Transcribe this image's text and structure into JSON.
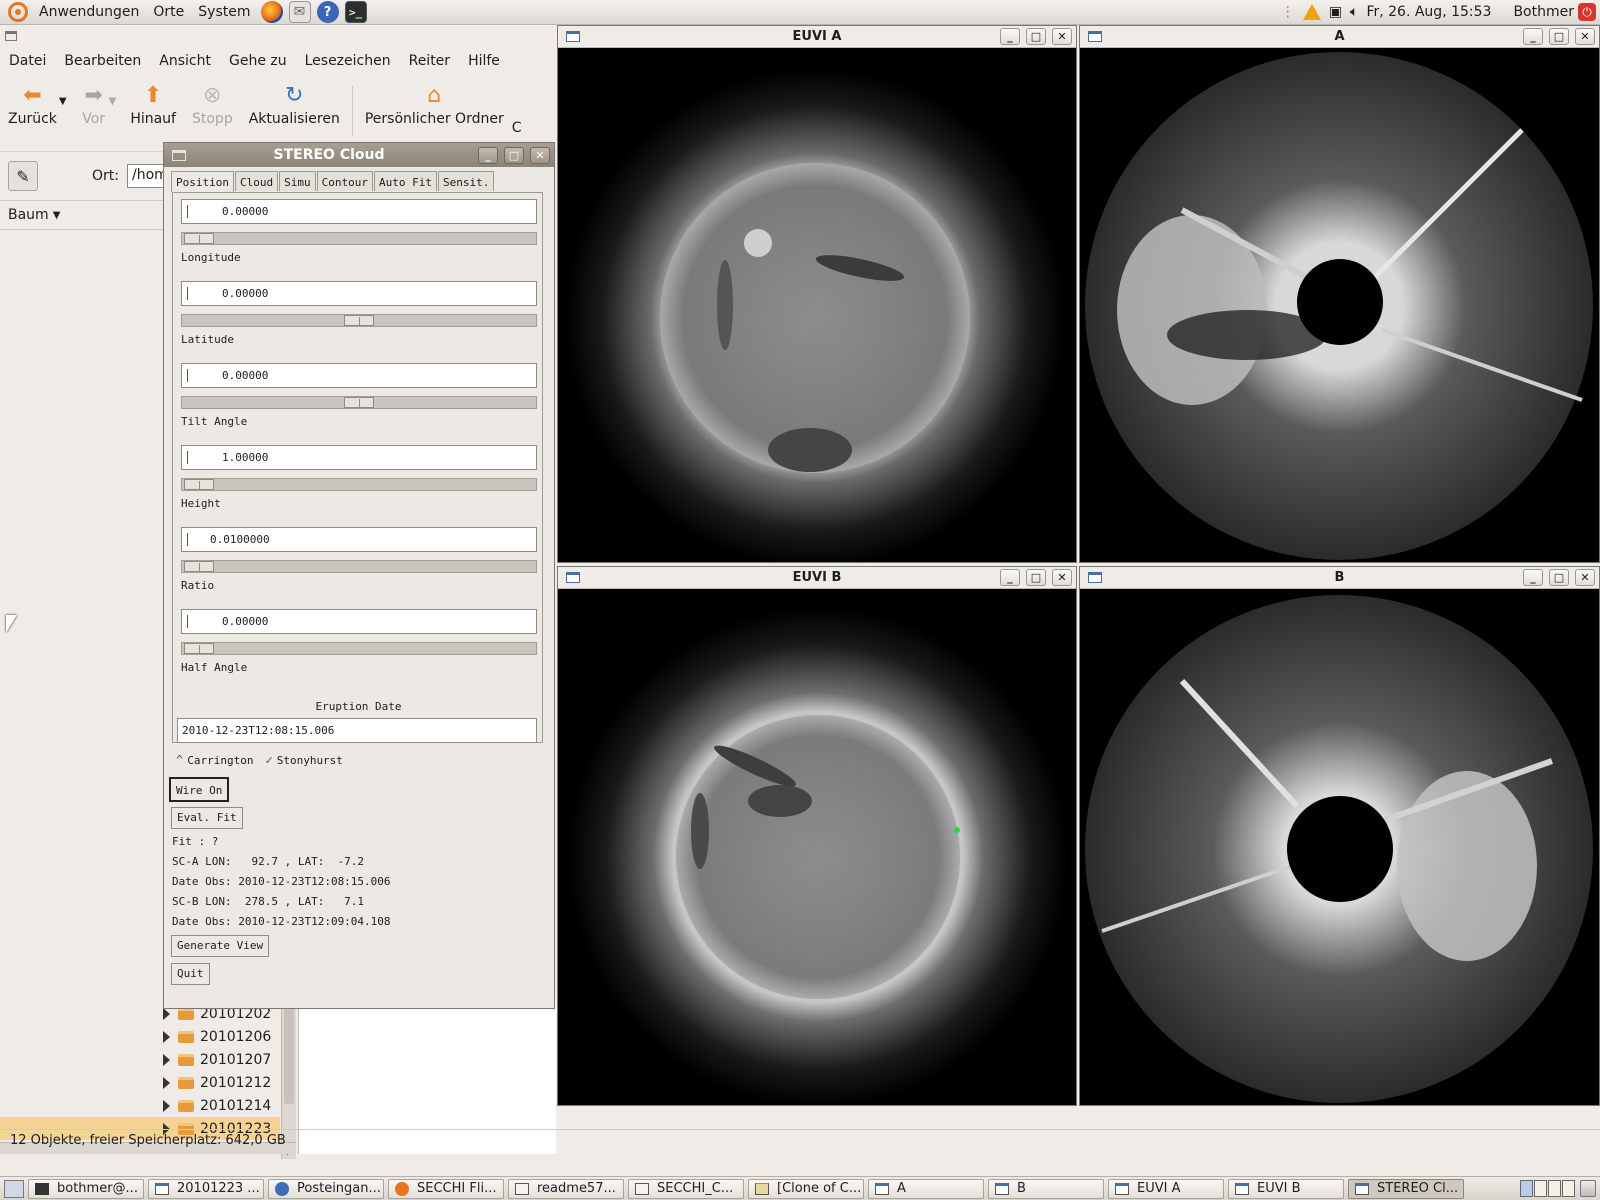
{
  "top_panel": {
    "menus": [
      "Anwendungen",
      "Orte",
      "System"
    ],
    "launchers": [
      "firefox-icon",
      "mail-icon",
      "help-icon",
      "terminal-icon"
    ],
    "clock": "Fr, 26. Aug, 15:53",
    "user": "Bothmer"
  },
  "nautilus": {
    "menubar": [
      "Datei",
      "Bearbeiten",
      "Ansicht",
      "Gehe zu",
      "Lesezeichen",
      "Reiter",
      "Hilfe"
    ],
    "toolbar": {
      "back": "Zurück",
      "forward": "Vor",
      "up": "Hinauf",
      "stop": "Stopp",
      "reload": "Aktualisieren",
      "home": "Persönlicher Ordner",
      "more": "C"
    },
    "location_label": "Ort:",
    "location_value": "/hom",
    "sidebar_mode": "Baum",
    "tree": [
      {
        "name": "20101202",
        "selected": false
      },
      {
        "name": "20101206",
        "selected": false
      },
      {
        "name": "20101207",
        "selected": false
      },
      {
        "name": "20101212",
        "selected": false
      },
      {
        "name": "20101214",
        "selected": false
      },
      {
        "name": "20101223",
        "selected": true
      }
    ],
    "status": "12 Objekte, freier Speicherplatz: 642,0 GB"
  },
  "image_windows": {
    "euvi_a": {
      "title": "EUVI A"
    },
    "cor_a": {
      "title": "A"
    },
    "euvi_b": {
      "title": "EUVI B"
    },
    "cor_b": {
      "title": "B"
    }
  },
  "stereo": {
    "title": "STEREO Cloud",
    "tabs": [
      "Position",
      "Cloud",
      "Simu",
      "Contour",
      "Auto Fit",
      "Sensit."
    ],
    "active_tab": "Position",
    "fields": [
      {
        "label": "Longitude",
        "value": "0.00000",
        "slider_fraction": 0.0
      },
      {
        "label": "Latitude",
        "value": "0.00000",
        "slider_fraction": 0.5
      },
      {
        "label": "Tilt Angle",
        "value": "0.00000",
        "slider_fraction": 0.5
      },
      {
        "label": "Height",
        "value": "1.00000",
        "slider_fraction": 0.0
      },
      {
        "label": "Ratio",
        "value": "0.0100000",
        "slider_fraction": 0.0
      },
      {
        "label": "Half Angle",
        "value": "0.00000",
        "slider_fraction": 0.0
      }
    ],
    "eruption_label": "Eruption Date",
    "eruption_value": "2010-12-23T12:08:15.006",
    "radios": [
      {
        "label": "Carrington",
        "mark": "^"
      },
      {
        "label": "Stonyhurst",
        "mark": "✓"
      }
    ],
    "buttons": {
      "wire": "Wire On",
      "eval": "Eval. Fit",
      "generate": "Generate View",
      "quit": "Quit"
    },
    "info": {
      "fit": "Fit : ?",
      "sca": "SC-A LON:   92.7 , LAT:  -7.2",
      "date_a": "Date Obs: 2010-12-23T12:08:15.006",
      "scb": "SC-B LON:  278.5 , LAT:   7.1",
      "date_b": "Date Obs: 2010-12-23T12:09:04.108"
    }
  },
  "taskbar": {
    "tasks": [
      {
        "label": "bothmer@...",
        "icon": "terminal-icon"
      },
      {
        "label": "20101223 ...",
        "icon": "folder-window-icon"
      },
      {
        "label": "Posteingan...",
        "icon": "mail-icon"
      },
      {
        "label": "SECCHI Fli...",
        "icon": "firefox-icon"
      },
      {
        "label": "readme57...",
        "icon": "text-editor-icon"
      },
      {
        "label": "SECCHI_C...",
        "icon": "document-icon"
      },
      {
        "label": "[Clone of C...",
        "icon": "box-icon"
      },
      {
        "label": "A",
        "icon": "window-icon"
      },
      {
        "label": "B",
        "icon": "window-icon"
      },
      {
        "label": "EUVI A",
        "icon": "window-icon"
      },
      {
        "label": "EUVI B",
        "icon": "window-icon"
      },
      {
        "label": "STEREO Cl...",
        "icon": "window-icon",
        "active": true
      }
    ]
  }
}
